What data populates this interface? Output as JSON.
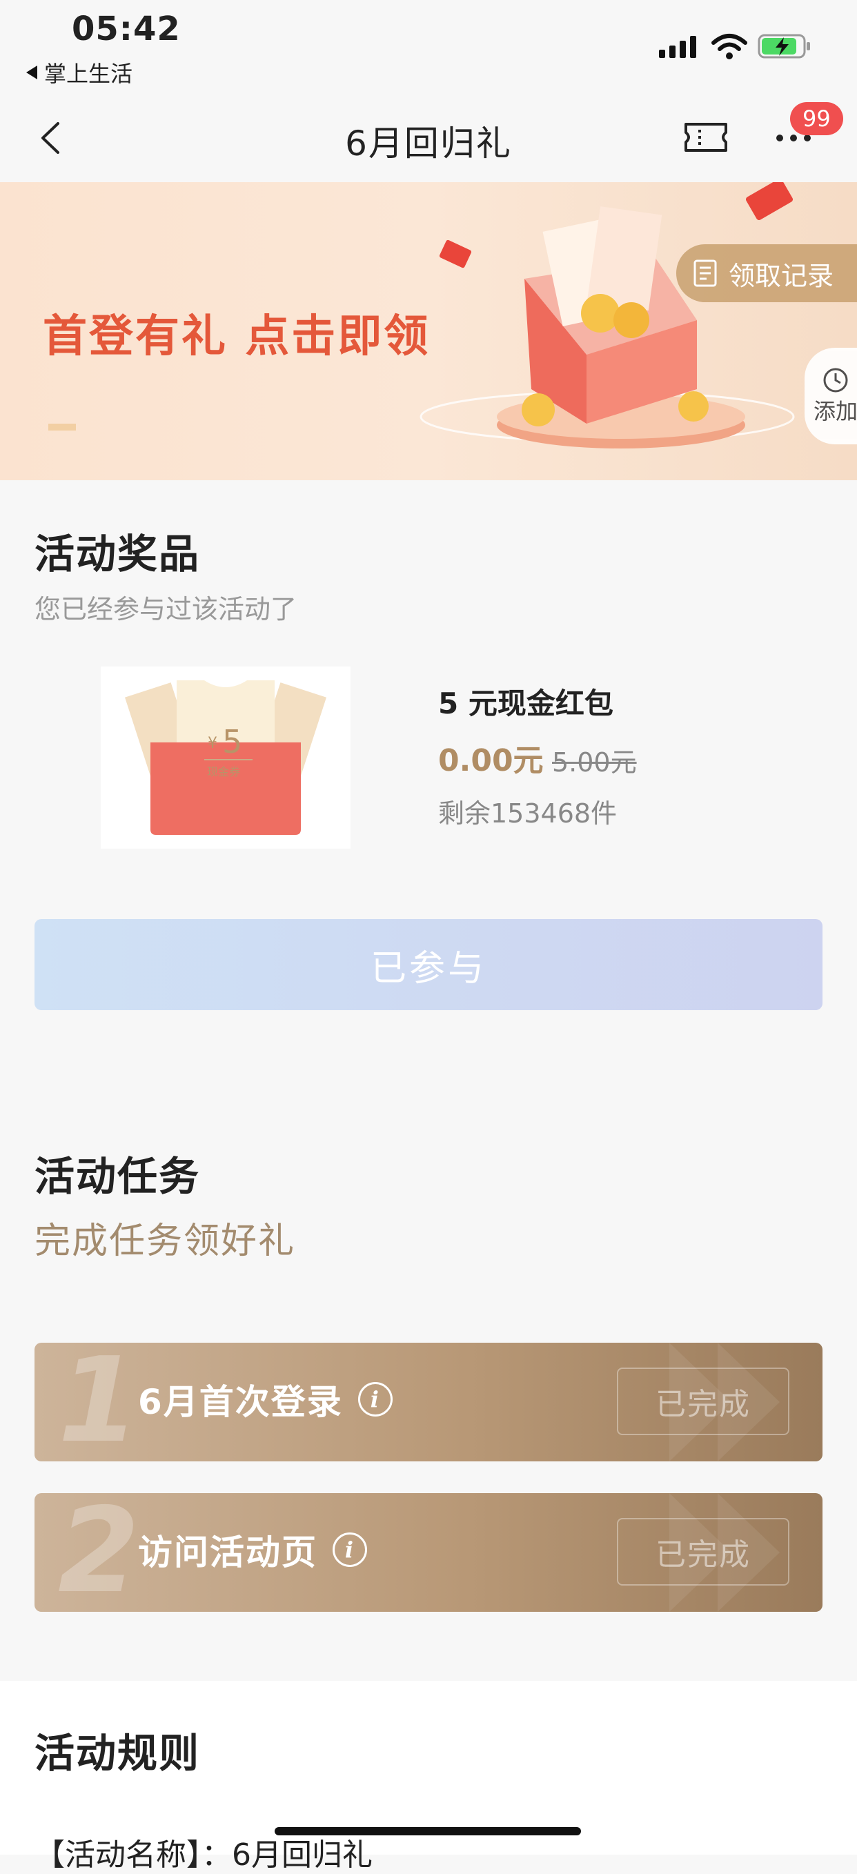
{
  "status_bar": {
    "time": "05:42",
    "back_app": "掌上生活"
  },
  "nav": {
    "title": "6月回归礼",
    "badge": "99"
  },
  "banner": {
    "headline": "首登有礼 点击即领",
    "record_label": "领取记录",
    "add_label": "添加"
  },
  "rewards": {
    "title": "活动奖品",
    "status": "您已经参与过该活动了",
    "prize": {
      "name": "5 元现金红包",
      "price": "0.00元",
      "original_price": "5.00元",
      "remaining": "剩余153468件",
      "voucher_amount": "5",
      "voucher_currency": "¥",
      "voucher_label": "现金券"
    },
    "joined_button": "已参与"
  },
  "tasks": {
    "title": "活动任务",
    "subtitle": "完成任务领好礼",
    "items": [
      {
        "num": "1",
        "label": "6月首次登录",
        "status": "已完成"
      },
      {
        "num": "2",
        "label": "访问活动页",
        "status": "已完成"
      }
    ]
  },
  "rules": {
    "title": "活动规则",
    "first_line": "【活动名称】：6月回归礼"
  },
  "colors": {
    "accent_gold": "#b08d64",
    "badge_red": "#f04f4f",
    "banner_text": "#e4583a"
  }
}
